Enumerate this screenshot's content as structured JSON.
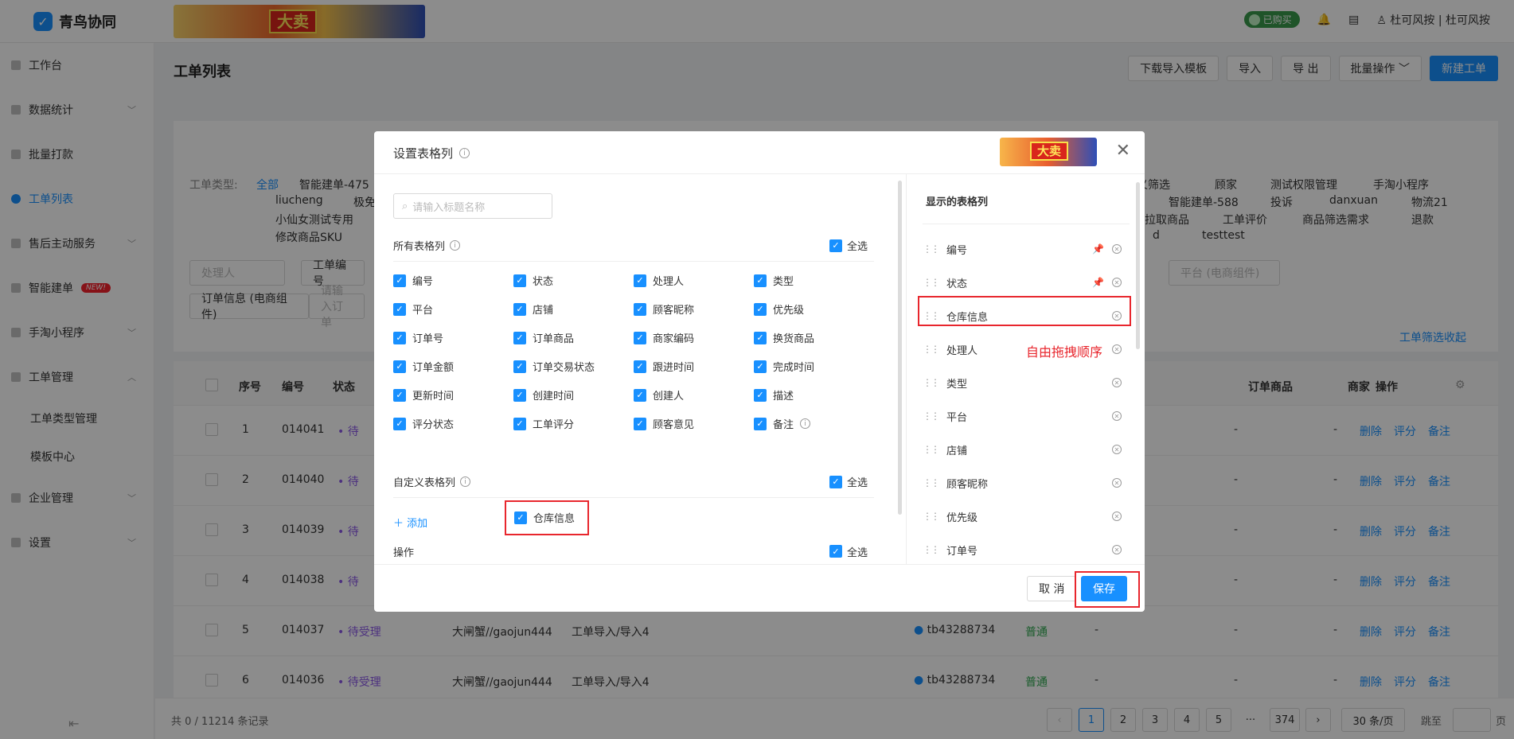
{
  "app": {
    "name": "青鸟协同",
    "bought": "已购买",
    "user": "杜可风按",
    "shop": "杜可风按"
  },
  "banner_text": "大卖",
  "sidebar": {
    "items": [
      {
        "label": "工作台"
      },
      {
        "label": "数据统计"
      },
      {
        "label": "批量打款"
      },
      {
        "label": "工单列表"
      },
      {
        "label": "售后主动服务"
      },
      {
        "label": "智能建单",
        "badge": "NEW!"
      },
      {
        "label": "手淘小程序"
      },
      {
        "label": "工单管理"
      },
      {
        "label": "工单类型管理"
      },
      {
        "label": "模板中心"
      },
      {
        "label": "企业管理"
      },
      {
        "label": "设置"
      }
    ]
  },
  "page": {
    "title": "工单列表",
    "buttons": [
      "下载导入模板",
      "导入",
      "导 出",
      "批量操作",
      "新建工单"
    ]
  },
  "filters": {
    "type_label": "工单类型:",
    "all": "全部",
    "row1_left": [
      "智能建单-475"
    ],
    "row1_right": [
      "义筛选",
      "顾家",
      "测试权限管理",
      "手淘小程序"
    ],
    "row2_left": [
      "liucheng",
      "极免"
    ],
    "row2_right": [
      "智能建单-588",
      "投诉",
      "danxuan",
      "物流21"
    ],
    "row3_left": [
      "小仙女测试专用"
    ],
    "row3_right": [
      "拉取商品",
      "工单评价",
      "商品筛选需求",
      "退款"
    ],
    "row4_left": [
      "修改商品SKU"
    ],
    "row4_right": [
      "d",
      "testtest"
    ],
    "handler_placeholder": "处理人",
    "order_no": "工单编号",
    "platform": "平台 (电商组件)",
    "order_info": "订单信息 (电商组件)",
    "order_info_placeholder": "请输入订单",
    "collapse": "工单筛选收起"
  },
  "table": {
    "headers": [
      "序号",
      "编号",
      "状态",
      "订单商品",
      "商家",
      "操作"
    ],
    "rows": [
      {
        "idx": "1",
        "no": "014041",
        "status": "待",
        "ops": [
          "删除",
          "评分",
          "备注"
        ],
        "dash": "-"
      },
      {
        "idx": "2",
        "no": "014040",
        "status": "待",
        "ops": [
          "删除",
          "评分",
          "备注"
        ],
        "dash": "-"
      },
      {
        "idx": "3",
        "no": "014039",
        "status": "待",
        "ops": [
          "删除",
          "评分",
          "备注"
        ],
        "dash": "-"
      },
      {
        "idx": "4",
        "no": "014038",
        "status": "待",
        "ops": [
          "删除",
          "评分",
          "备注"
        ],
        "dash": "-"
      },
      {
        "idx": "5",
        "no": "014037",
        "status": "待受理",
        "handler": "大闸蟹//gaojun444",
        "type": "工单导入/导入4",
        "shop": "tb43288734",
        "priority": "普通",
        "ops": [
          "删除",
          "评分",
          "备注"
        ],
        "dash": "-"
      },
      {
        "idx": "6",
        "no": "014036",
        "status": "待受理",
        "handler": "大闸蟹//gaojun444",
        "type": "工单导入/导入4",
        "shop": "tb43288734",
        "priority": "普通",
        "ops": [
          "删除",
          "评分",
          "备注"
        ],
        "dash": "-"
      }
    ]
  },
  "pager": {
    "total": "共 0 / 11214 条记录",
    "pages": [
      "1",
      "2",
      "3",
      "4",
      "5",
      "···",
      "374"
    ],
    "size": "30 条/页",
    "jump": "跳至",
    "page_unit": "页"
  },
  "modal": {
    "title": "设置表格列",
    "search_placeholder": "请输入标题名称",
    "all_cols": "所有表格列",
    "select_all": "全选",
    "options": [
      "编号",
      "状态",
      "处理人",
      "类型",
      "平台",
      "店铺",
      "顾客昵称",
      "优先级",
      "订单号",
      "订单商品",
      "商家编码",
      "换货商品",
      "订单金额",
      "订单交易状态",
      "跟进时间",
      "完成时间",
      "更新时间",
      "创建时间",
      "创建人",
      "描述",
      "评分状态",
      "工单评分",
      "顾客意见",
      "备注"
    ],
    "custom_cols": "自定义表格列",
    "add": "添加",
    "custom_item": "仓库信息",
    "ops_section": "操作",
    "shown_title": "显示的表格列",
    "shown": [
      "编号",
      "状态",
      "仓库信息",
      "处理人",
      "类型",
      "平台",
      "店铺",
      "顾客昵称",
      "优先级",
      "订单号"
    ],
    "drag_note": "自由拖拽顺序",
    "cancel": "取 消",
    "save": "保存"
  }
}
